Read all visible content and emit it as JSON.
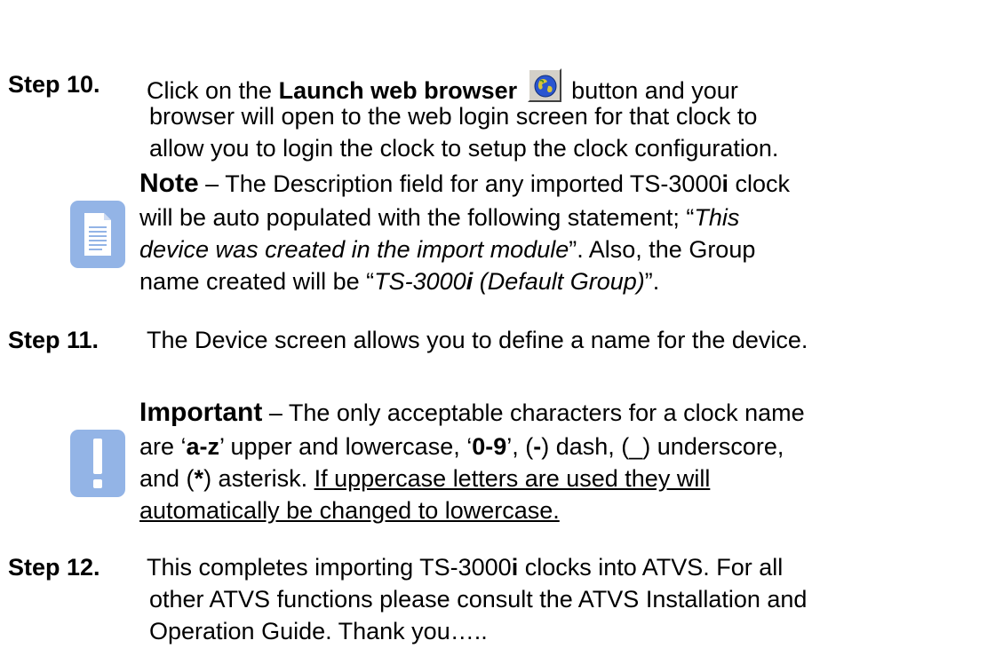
{
  "colors": {
    "icon_bg": "#93b4e6",
    "icon_fg": "#ffffff",
    "text": "#000000"
  },
  "step10": {
    "label": "Step 10.",
    "l1_pre": "Click on the ",
    "l1_bold": "Launch web browser",
    "l1_post": "button and your",
    "l2": "browser will open to the web login screen for that clock to",
    "l3": "allow you to login the clock to setup the clock configuration.",
    "button_icon": "globe-icon"
  },
  "note": {
    "icon": "document-icon",
    "head": "Note",
    "l1_rest": " – The Description field for any imported TS-3000",
    "l1_i": "i",
    "l1_end": " clock",
    "l2_pre": "will be auto populated with the following statement; “",
    "l2_ital": "This",
    "l3_ital": "device was created in the import module",
    "l3_post": "”. Also, the Group",
    "l4_pre": "name created will be “",
    "l4_ital_a": "TS-3000",
    "l4_ital_i": "i",
    "l4_ital_b": " (Default Group)",
    "l4_post": "”."
  },
  "step11": {
    "label": "Step 11.",
    "text": "The Device screen allows you to define a name for the device."
  },
  "important": {
    "icon": "exclamation-icon",
    "head": "Important",
    "l1_rest": " – The only acceptable characters for a clock name",
    "l2_a": "are ‘",
    "l2_b": "a-z",
    "l2_c": "’ upper and lowercase, ‘",
    "l2_d": "0-9",
    "l2_e": "’, (",
    "l2_f": "-",
    "l2_g": ") dash, (_) underscore,",
    "l3_a": "and (",
    "l3_b": "*",
    "l3_c": ") asterisk. ",
    "l3_u": "If uppercase letters are used they will",
    "l4_u": "automatically be changed to lowercase."
  },
  "step12": {
    "label": "Step 12.",
    "l1_pre": "This completes importing TS-3000",
    "l1_i": "i",
    "l1_post": " clocks into ATVS. For all",
    "l2": "other ATVS functions please consult the ATVS Installation and",
    "l3": "Operation Guide. Thank you….."
  }
}
